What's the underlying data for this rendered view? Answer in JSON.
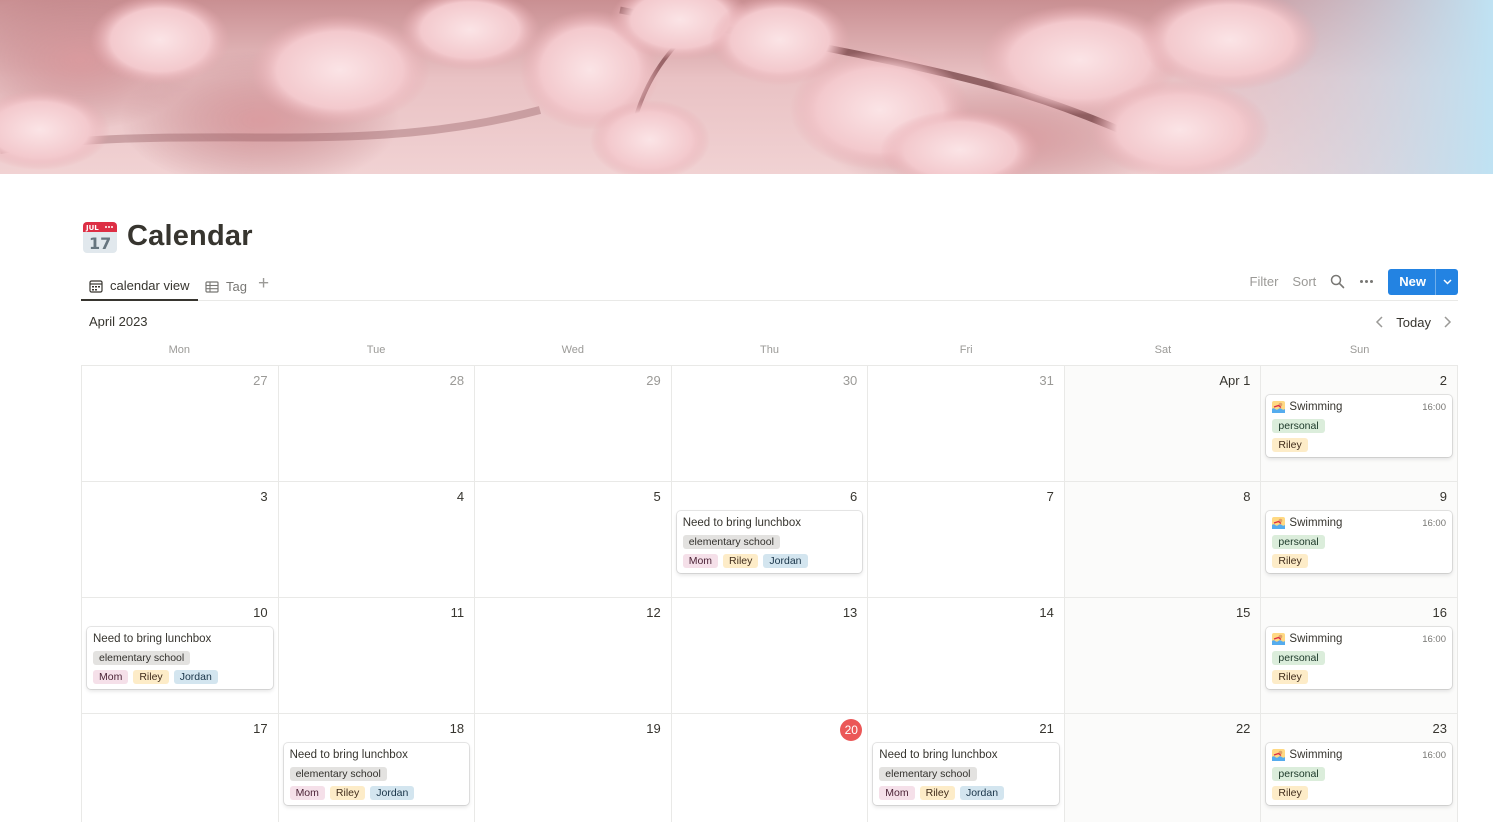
{
  "page": {
    "title": "Calendar",
    "icon": "calendar-17-icon"
  },
  "views": [
    {
      "label": "calendar view",
      "icon": "calendar-icon",
      "active": true
    },
    {
      "label": "Tag",
      "icon": "table-icon",
      "active": false
    }
  ],
  "add_view_icon": "plus-icon",
  "toolbar": {
    "filter": "Filter",
    "sort": "Sort",
    "search_icon": "search-icon",
    "more_icon": "more-icon",
    "new_label": "New",
    "new_dropdown_icon": "chevron-down-icon"
  },
  "month": {
    "label": "April 2023",
    "today": "Today",
    "prev_icon": "chevron-left-icon",
    "next_icon": "chevron-right-icon"
  },
  "weekdays": [
    "Mon",
    "Tue",
    "Wed",
    "Thu",
    "Fri",
    "Sat",
    "Sun"
  ],
  "colors": {
    "accent": "#2383e2",
    "today": "#eb5757"
  },
  "weeks": [
    [
      {
        "day": "27",
        "faded": true,
        "weekend": false
      },
      {
        "day": "28",
        "faded": true,
        "weekend": false
      },
      {
        "day": "29",
        "faded": true,
        "weekend": false
      },
      {
        "day": "30",
        "faded": true,
        "weekend": false
      },
      {
        "day": "31",
        "faded": true,
        "weekend": false
      },
      {
        "day": "Apr 1",
        "weekend": true
      },
      {
        "day": "2",
        "weekend": true,
        "event": {
          "title": "Swimming",
          "icon": "swimmer-icon",
          "time": "16:00",
          "tag_rows": [
            [
              {
                "label": "personal",
                "color": "green"
              }
            ],
            [
              {
                "label": "Riley",
                "color": "yellow"
              }
            ]
          ]
        }
      }
    ],
    [
      {
        "day": "3",
        "weekend": false
      },
      {
        "day": "4",
        "weekend": false
      },
      {
        "day": "5",
        "weekend": false
      },
      {
        "day": "6",
        "weekend": false,
        "event": {
          "title": "Need to bring lunchbox",
          "tag_rows": [
            [
              {
                "label": "elementary school",
                "color": "gray"
              }
            ],
            [
              {
                "label": "Mom",
                "color": "pink"
              },
              {
                "label": "Riley",
                "color": "yellow"
              },
              {
                "label": "Jordan",
                "color": "blue"
              }
            ]
          ]
        }
      },
      {
        "day": "7",
        "weekend": false
      },
      {
        "day": "8",
        "weekend": true
      },
      {
        "day": "9",
        "weekend": true,
        "event": {
          "title": "Swimming",
          "icon": "swimmer-icon",
          "time": "16:00",
          "tag_rows": [
            [
              {
                "label": "personal",
                "color": "green"
              }
            ],
            [
              {
                "label": "Riley",
                "color": "yellow"
              }
            ]
          ]
        }
      }
    ],
    [
      {
        "day": "10",
        "weekend": false,
        "event": {
          "title": "Need to bring lunchbox",
          "tag_rows": [
            [
              {
                "label": "elementary school",
                "color": "gray"
              }
            ],
            [
              {
                "label": "Mom",
                "color": "pink"
              },
              {
                "label": "Riley",
                "color": "yellow"
              },
              {
                "label": "Jordan",
                "color": "blue"
              }
            ]
          ]
        }
      },
      {
        "day": "11",
        "weekend": false
      },
      {
        "day": "12",
        "weekend": false
      },
      {
        "day": "13",
        "weekend": false
      },
      {
        "day": "14",
        "weekend": false
      },
      {
        "day": "15",
        "weekend": true
      },
      {
        "day": "16",
        "weekend": true,
        "event": {
          "title": "Swimming",
          "icon": "swimmer-icon",
          "time": "16:00",
          "tag_rows": [
            [
              {
                "label": "personal",
                "color": "green"
              }
            ],
            [
              {
                "label": "Riley",
                "color": "yellow"
              }
            ]
          ]
        }
      }
    ],
    [
      {
        "day": "17",
        "weekend": false
      },
      {
        "day": "18",
        "weekend": false,
        "event": {
          "title": "Need to bring lunchbox",
          "tag_rows": [
            [
              {
                "label": "elementary school",
                "color": "gray"
              }
            ],
            [
              {
                "label": "Mom",
                "color": "pink"
              },
              {
                "label": "Riley",
                "color": "yellow"
              },
              {
                "label": "Jordan",
                "color": "blue"
              }
            ]
          ]
        }
      },
      {
        "day": "19",
        "weekend": false
      },
      {
        "day": "20",
        "weekend": false,
        "today": true
      },
      {
        "day": "21",
        "weekend": false,
        "event": {
          "title": "Need to bring lunchbox",
          "tag_rows": [
            [
              {
                "label": "elementary school",
                "color": "gray"
              }
            ],
            [
              {
                "label": "Mom",
                "color": "pink"
              },
              {
                "label": "Riley",
                "color": "yellow"
              },
              {
                "label": "Jordan",
                "color": "blue"
              }
            ]
          ]
        }
      },
      {
        "day": "22",
        "weekend": true
      },
      {
        "day": "23",
        "weekend": true,
        "event": {
          "title": "Swimming",
          "icon": "swimmer-icon",
          "time": "16:00",
          "tag_rows": [
            [
              {
                "label": "personal",
                "color": "green"
              }
            ],
            [
              {
                "label": "Riley",
                "color": "yellow"
              }
            ]
          ]
        }
      }
    ]
  ]
}
